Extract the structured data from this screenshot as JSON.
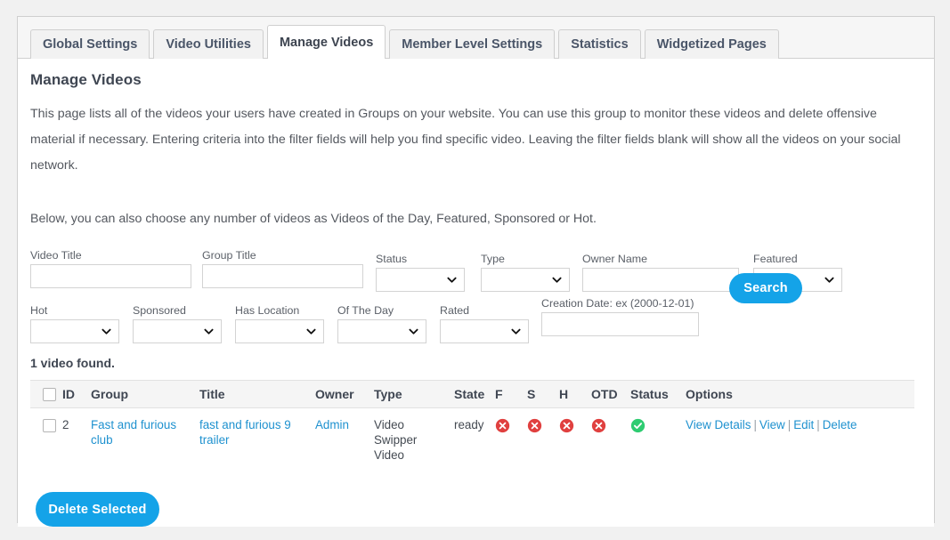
{
  "tabs": [
    {
      "label": "Global Settings",
      "active": false
    },
    {
      "label": "Video Utilities",
      "active": false
    },
    {
      "label": "Manage Videos",
      "active": true
    },
    {
      "label": "Member Level Settings",
      "active": false
    },
    {
      "label": "Statistics",
      "active": false
    },
    {
      "label": "Widgetized Pages",
      "active": false
    }
  ],
  "page": {
    "title": "Manage Videos",
    "description": "This page lists all of the videos your users have created in Groups on your website. You can use this group to monitor these videos and delete offensive material if necessary. Entering criteria into the filter fields will help you find specific video. Leaving the filter fields blank will show all the videos on your social network.",
    "description2": "Below, you can also choose any number of videos as Videos of the Day, Featured, Sponsored or Hot."
  },
  "filters": {
    "video_title": {
      "label": "Video Title",
      "value": "",
      "placeholder": ""
    },
    "group_title": {
      "label": "Group Title",
      "value": "",
      "placeholder": ""
    },
    "status": {
      "label": "Status",
      "value": ""
    },
    "type": {
      "label": "Type",
      "value": ""
    },
    "owner_name": {
      "label": "Owner Name",
      "value": "",
      "placeholder": ""
    },
    "featured": {
      "label": "Featured",
      "value": ""
    },
    "hot": {
      "label": "Hot",
      "value": ""
    },
    "sponsored": {
      "label": "Sponsored",
      "value": ""
    },
    "has_location": {
      "label": "Has Location",
      "value": ""
    },
    "of_the_day": {
      "label": "Of The Day",
      "value": ""
    },
    "rated": {
      "label": "Rated",
      "value": ""
    },
    "creation_date": {
      "label": "Creation Date: ex (2000-12-01)",
      "value": "",
      "placeholder": ""
    },
    "search_button": "Search"
  },
  "results": {
    "count_text": "1 video found.",
    "columns": [
      "ID",
      "Group",
      "Title",
      "Owner",
      "Type",
      "State",
      "F",
      "S",
      "H",
      "OTD",
      "Status",
      "Options"
    ],
    "rows": [
      {
        "id": "2",
        "group": "Fast and furious club",
        "title": "fast and furious 9 trailer",
        "owner": "Admin",
        "type": "Video Swipper Video",
        "state": "ready",
        "featured": "no",
        "sponsored": "no",
        "hot": "no",
        "otd": "no",
        "status": "yes",
        "options": [
          "View Details",
          "View",
          "Edit",
          "Delete"
        ],
        "option_separator": "|"
      }
    ],
    "delete_button": "Delete Selected"
  },
  "icons": {
    "chevron_down": "chevron-down-icon",
    "cross_circle": "cross-circle-icon",
    "check_circle": "check-circle-icon"
  },
  "colors": {
    "accent": "#14a3e8",
    "link": "#1e91cf",
    "negative": "#e0403f",
    "positive": "#2ecc71",
    "panel_bg": "#ffffff",
    "page_bg": "#f1f1f1",
    "header_bg": "#f5f5f5"
  }
}
